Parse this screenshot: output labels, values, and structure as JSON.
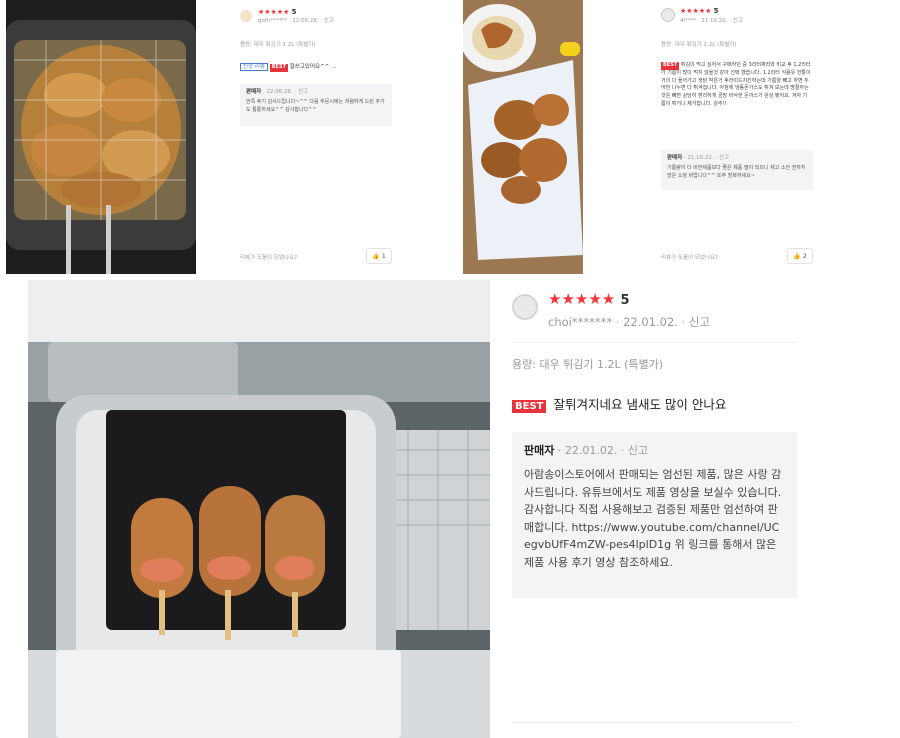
{
  "reviews_small": [
    {
      "rating": "5",
      "stars": "★★★★★",
      "user": "goth******",
      "date": "22.06.28.",
      "report": "신고",
      "option": "용량: 대우 튀김기 1.2L (특별가)",
      "new_badge": "신상 리뷰",
      "best_badge": "BEST",
      "text": "잘쓰고있어요^^ ...",
      "seller_label": "판매자",
      "seller_date": "22.06.28.",
      "seller_report": "신고",
      "seller_text": "만족 후기 감사드립니다~^^ 다음 주문시에는 저렴하게 드린 추가도 통통하세요^^ 감사합니다^^",
      "helpful_q": "리뷰가 도움이 되었나요?",
      "helpful_count": "1"
    },
    {
      "rating": "5",
      "stars": "★★★★★",
      "user": "4i****",
      "date": "21.10.20.",
      "report": "신고",
      "option": "용량: 대우 튀김기 1.2L (특별가)",
      "best_badge": "BEST",
      "text": "튀김이 먹고 싶어서 구매하던 중 3리터짜리와 비교 후 1.2리터가 기름이 많이 먹지 않을것 같아 선택 했습니다. 1.2리터 식용유 한통이 거의 다 들어가고 생닭 작은거 후라이드치킨하는데 기름양 빼고 하면 두어번 나누면 다 튀겨집니다. 아침에 냉동돈가스도 튀겨 보는데 명절하는것은 빼면 상당히 편리하게 금방 바삭한 돈까스가 완성 됐어요. 겨자 기름이 튀거나 제거합니다. 강추!!",
      "seller_label": "판매자",
      "seller_date": "21.10.21.",
      "seller_report": "신고",
      "seller_text": "기름량이 더 비싼제품보다 좋은 제품 딸이 되므니 제고 소진 전까지 많은 소정 바랍니다^^ 또주 방복하세요~",
      "helpful_q": "리뷰가 도움이 되었나요?",
      "helpful_count": "2"
    }
  ],
  "review_main": {
    "stars": "★★★★★",
    "rating": "5",
    "user": "choi*******",
    "date": "22.01.02.",
    "report": "신고",
    "option": "용량: 대우 튀김기 1.2L (특별가)",
    "best_badge": "BEST",
    "text": "잘튀겨지네요 냄새도 많이 안나요",
    "seller_label": "판매자",
    "seller_date": "22.01.02.",
    "seller_report": "신고",
    "seller_text": "아람송이스토어에서 판매되는 엄선된 제품, 많은 사랑 감사드립니다. 유튜브에서도 제품 영상을 보실수 있습니다. 감사합니다 직접 사용해보고 검증된 제품만 엄선하여 판매합니다.",
    "seller_link": "https://www.youtube.com/channel/UCegvbUfF4mZW-pes4lplD1g",
    "seller_tail": "위 링크를 통해서 많은 제품 사용 후기 영상 참조하세요."
  },
  "colors": {
    "accent": "#e8333c",
    "reply_bg": "#f4f4f6"
  },
  "icons": {
    "thumb": "thumbs-up-icon",
    "avatar": "user-avatar-icon"
  }
}
